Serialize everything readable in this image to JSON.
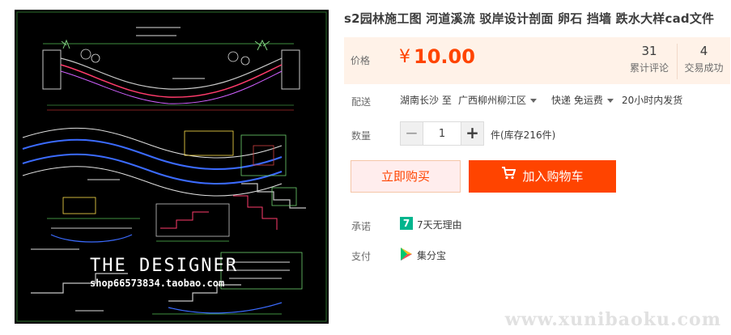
{
  "product": {
    "title": "s2园林施工图 河道溪流 驳岸设计剖面 卵石 挡墙 跌水大样cad文件",
    "image": {
      "watermark_title": "THE DESIGNER",
      "watermark_shop": "shop66573834.taobao.com"
    }
  },
  "price": {
    "label": "价格",
    "currency": "¥",
    "value": "10.00",
    "reviews_count": "31",
    "reviews_label": "累计评论",
    "sales_count": "4",
    "sales_label": "交易成功"
  },
  "shipping": {
    "label": "配送",
    "from": "湖南长沙 至",
    "to": "广西柳州柳江区",
    "method": "快递 免运费",
    "dispatch": "20小时内发货"
  },
  "quantity": {
    "label": "数量",
    "minus": "−",
    "value": "1",
    "plus": "+",
    "stock": "件(库存216件)"
  },
  "actions": {
    "buy_now": "立即购买",
    "add_to_cart": "加入购物车"
  },
  "promise": {
    "label": "承诺",
    "icon_text": "7",
    "text": "7天无理由"
  },
  "payment": {
    "label": "支付",
    "text": "集分宝"
  },
  "site_watermark": "www.xunibaoku.com",
  "colors": {
    "accent": "#ff4400",
    "price_bg": "#fff2e8",
    "promise_green": "#00b58d"
  },
  "icons": [
    "cart-icon",
    "seven-day-icon",
    "jifenbao-icon",
    "caret-down-icon"
  ]
}
